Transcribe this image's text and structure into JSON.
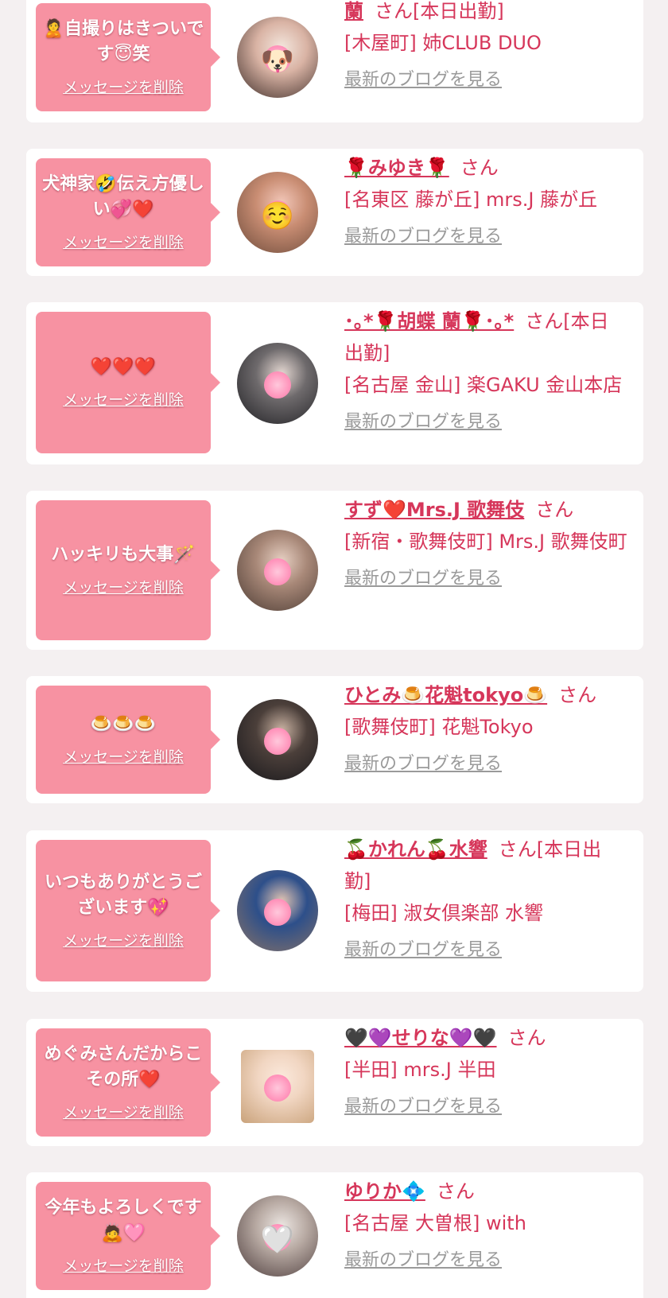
{
  "entries": [
    {
      "message": "🙎自撮りはきついです😇笑",
      "delete_label": "メッセージを削除",
      "name": "蘭",
      "honorific": "さん[本日出勤]",
      "shop": "[木屋町] 姉CLUB DUO",
      "blog_link": "最新のブログを見る",
      "avatar_colors": [
        "#3a2a26",
        "#d9b3a4",
        "#f3e6dd"
      ],
      "avatar_mark": "🐶"
    },
    {
      "message": "犬神家🤣伝え方優しい💞❤️",
      "delete_label": "メッセージを削除",
      "name": "🌹みゆき🌹",
      "honorific": "さん",
      "shop": "[名東区 藤が丘] mrs.J 藤が丘",
      "blog_link": "最新のブログを見る",
      "avatar_colors": [
        "#6b4a3a",
        "#c98d73",
        "#f2c7b9"
      ],
      "avatar_mark": "☺️"
    },
    {
      "message": "❤️❤️❤️",
      "delete_label": "メッセージを削除",
      "name": "･｡*🌹胡蝶 蘭🌹･｡*",
      "honorific": "さん[本日出勤]",
      "shop": "[名古屋 金山] 楽GAKU 金山本店",
      "blog_link": "最新のブログを見る",
      "avatar_colors": [
        "#1e1e22",
        "#6e6a6c",
        "#e5d8d2"
      ],
      "avatar_mark": ""
    },
    {
      "message": "ハッキリも大事🪄",
      "delete_label": "メッセージを削除",
      "name": "すず❤️Mrs.J 歌舞伎",
      "honorific": "さん",
      "shop": "[新宿・歌舞伎町] Mrs.J 歌舞伎町",
      "blog_link": "最新のブログを見る",
      "avatar_colors": [
        "#4a3a32",
        "#a88878",
        "#e6cfc2"
      ],
      "avatar_mark": ""
    },
    {
      "message": "🍮🍮🍮",
      "delete_label": "メッセージを削除",
      "name": "ひとみ🍮花魁tokyo🍮",
      "honorific": "さん",
      "shop": "[歌舞伎町] 花魁Tokyo",
      "blog_link": "最新のブログを見る",
      "avatar_colors": [
        "#16161a",
        "#4b3f3a",
        "#c9b2a2"
      ],
      "avatar_mark": ""
    },
    {
      "message": "いつもありがとうございます💖",
      "delete_label": "メッセージを削除",
      "name": "🍒かれん🍒水響",
      "honorific": "さん[本日出勤]",
      "shop": "[梅田] 淑女倶楽部 水響",
      "blog_link": "最新のブログを見る",
      "avatar_colors": [
        "#8a7366",
        "#2d4f8a",
        "#e2c4b2"
      ],
      "avatar_mark": ""
    },
    {
      "message": "めぐみさんだからこその所❤️",
      "delete_label": "メッセージを削除",
      "name": "🖤💜せりな💜🖤",
      "honorific": "さん",
      "shop": "[半田] mrs.J 半田",
      "blog_link": "最新のブログを見る",
      "avatar_colors": [
        "#c9a27a",
        "#f1d6c2",
        "#fbe9dc"
      ],
      "avatar_mark": ""
    },
    {
      "message": "今年もよろしくです🙇🩷",
      "delete_label": "メッセージを削除",
      "name": "ゆりか💠",
      "honorific": "さん",
      "shop": "[名古屋 大曽根] with",
      "blog_link": "最新のブログを見る",
      "avatar_colors": [
        "#4a3a3a",
        "#b7a9a2",
        "#ece6e2"
      ],
      "avatar_mark": "🤍"
    }
  ]
}
